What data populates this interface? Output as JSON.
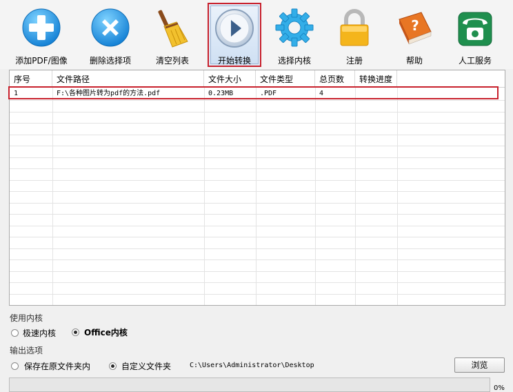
{
  "toolbar": {
    "buttons": [
      {
        "label": "添加PDF/图像",
        "icon": "add-plus-icon"
      },
      {
        "label": "删除选择项",
        "icon": "delete-x-icon"
      },
      {
        "label": "清空列表",
        "icon": "broom-icon"
      },
      {
        "label": "开始转换",
        "icon": "play-icon",
        "active": true
      },
      {
        "label": "选择内核",
        "icon": "gear-icon"
      },
      {
        "label": "注册",
        "icon": "lock-icon"
      },
      {
        "label": "帮助",
        "icon": "help-book-icon"
      },
      {
        "label": "人工服务",
        "icon": "phone-icon"
      }
    ]
  },
  "table": {
    "columns": [
      "序号",
      "文件路径",
      "文件大小",
      "文件类型",
      "总页数",
      "转换进度"
    ],
    "rows": [
      {
        "index": "1",
        "path": "F:\\各种图片转为pdf的方法.pdf",
        "size": "0.23MB",
        "type": ".PDF",
        "pages": "4",
        "progress": ""
      }
    ]
  },
  "engine": {
    "section_label": "使用内核",
    "options": [
      {
        "label": "极速内核",
        "checked": false
      },
      {
        "label": "Office内核",
        "checked": true
      }
    ]
  },
  "output": {
    "section_label": "输出选项",
    "options": [
      {
        "label": "保存在原文件夹内",
        "checked": false
      },
      {
        "label": "自定义文件夹",
        "checked": true
      }
    ],
    "path": "C:\\Users\\Administrator\\Desktop",
    "browse_label": "浏览"
  },
  "progress": {
    "value": 0,
    "label": "0%"
  },
  "colors": {
    "highlight_border": "#c8202c",
    "accent_blue": "#2a9be0",
    "progress_green": "#3cb043"
  }
}
